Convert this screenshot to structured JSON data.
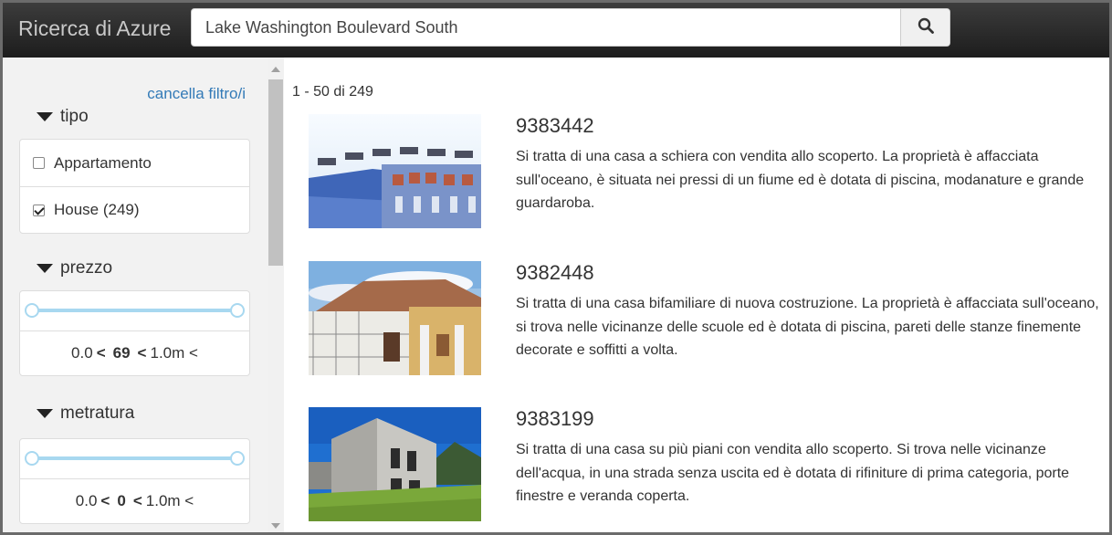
{
  "header": {
    "brand": "Ricerca di Azure",
    "search_value": "Lake Washington Boulevard South",
    "search_icon": "search-icon"
  },
  "sidebar": {
    "clear_filters": "cancella filtro/i",
    "facets": {
      "type": {
        "title": "tipo",
        "options": [
          {
            "label": "Appartamento",
            "checked": false
          },
          {
            "label": "House (249)",
            "checked": true
          }
        ]
      },
      "price": {
        "title": "prezzo",
        "min": "0.0",
        "sep1": "<",
        "count": "69",
        "sep2": "<",
        "max": "1.0m <"
      },
      "area": {
        "title": "metratura",
        "min": "0.0",
        "sep1": "<",
        "count": "0",
        "sep2": "<",
        "max": "1.0m <"
      }
    }
  },
  "results": {
    "count_text": "1 - 50 di 249",
    "items": [
      {
        "id": "9383442",
        "description": "Si tratta di una casa a schiera con vendita allo scoperto. La proprietà è affacciata sull'oceano, è situata nei pressi di un fiume ed è dotata di piscina, modanature e grande guardaroba."
      },
      {
        "id": "9382448",
        "description": "Si tratta di una casa bifamiliare di nuova costruzione. La proprietà è affacciata sull'oceano, si trova nelle vicinanze delle scuole ed è dotata di piscina, pareti delle stanze finemente decorate e soffitti a volta."
      },
      {
        "id": "9383199",
        "description": "Si tratta di una casa su più piani con vendita allo scoperto. Si trova nelle vicinanze dell'acqua, in una strada senza uscita ed è dotata di rifiniture di prima categoria, porte finestre e veranda coperta."
      }
    ]
  },
  "colors": {
    "link": "#337ab7",
    "slider": "#a8d8f0",
    "topbar": "#2b2b2b"
  }
}
